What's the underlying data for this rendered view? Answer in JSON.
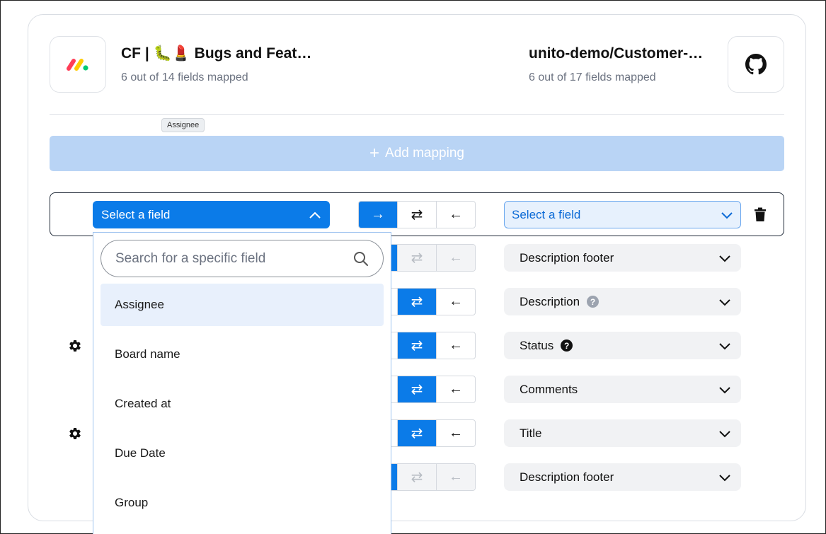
{
  "left_service": {
    "title": "CF | 🐛💄 Bugs and Feat…",
    "subtitle": "6 out of 14 fields mapped",
    "icon": "monday-logo-icon"
  },
  "right_service": {
    "title": "unito-demo/Customer-…",
    "subtitle": "6 out of 17 fields mapped",
    "icon": "github-logo-icon"
  },
  "tooltip": "Assignee",
  "add_mapping": {
    "label": "Add mapping"
  },
  "active_row": {
    "left_select": "Select a field",
    "right_select": "Select a field",
    "arrows": [
      "→",
      "⇄",
      "←"
    ]
  },
  "dropdown": {
    "search_placeholder": "Search for a specific field",
    "options": [
      "Assignee",
      "Board name",
      "Created at",
      "Due Date",
      "Group"
    ]
  },
  "mappings": [
    {
      "right_field": "Description footer",
      "arrows": [
        "⇄",
        "←"
      ],
      "state": "one-way"
    },
    {
      "right_field": "Description",
      "arrows": [
        "⇄",
        "←"
      ],
      "state": "two-way",
      "help": "?"
    },
    {
      "right_field": "Status",
      "arrows": [
        "⇄",
        "←"
      ],
      "state": "two-way",
      "help": "?"
    },
    {
      "right_field": "Comments",
      "arrows": [
        "⇄",
        "←"
      ],
      "state": "two-way"
    },
    {
      "right_field": "Title",
      "arrows": [
        "⇄",
        "←"
      ],
      "state": "two-way"
    },
    {
      "right_field": "Description footer",
      "arrows": [
        "⇄",
        "←"
      ],
      "state": "one-way"
    }
  ],
  "colors": {
    "primary": "#0b7be8",
    "add_mapping_bg": "#b9d4f5",
    "field_bg": "#f1f2f4"
  }
}
